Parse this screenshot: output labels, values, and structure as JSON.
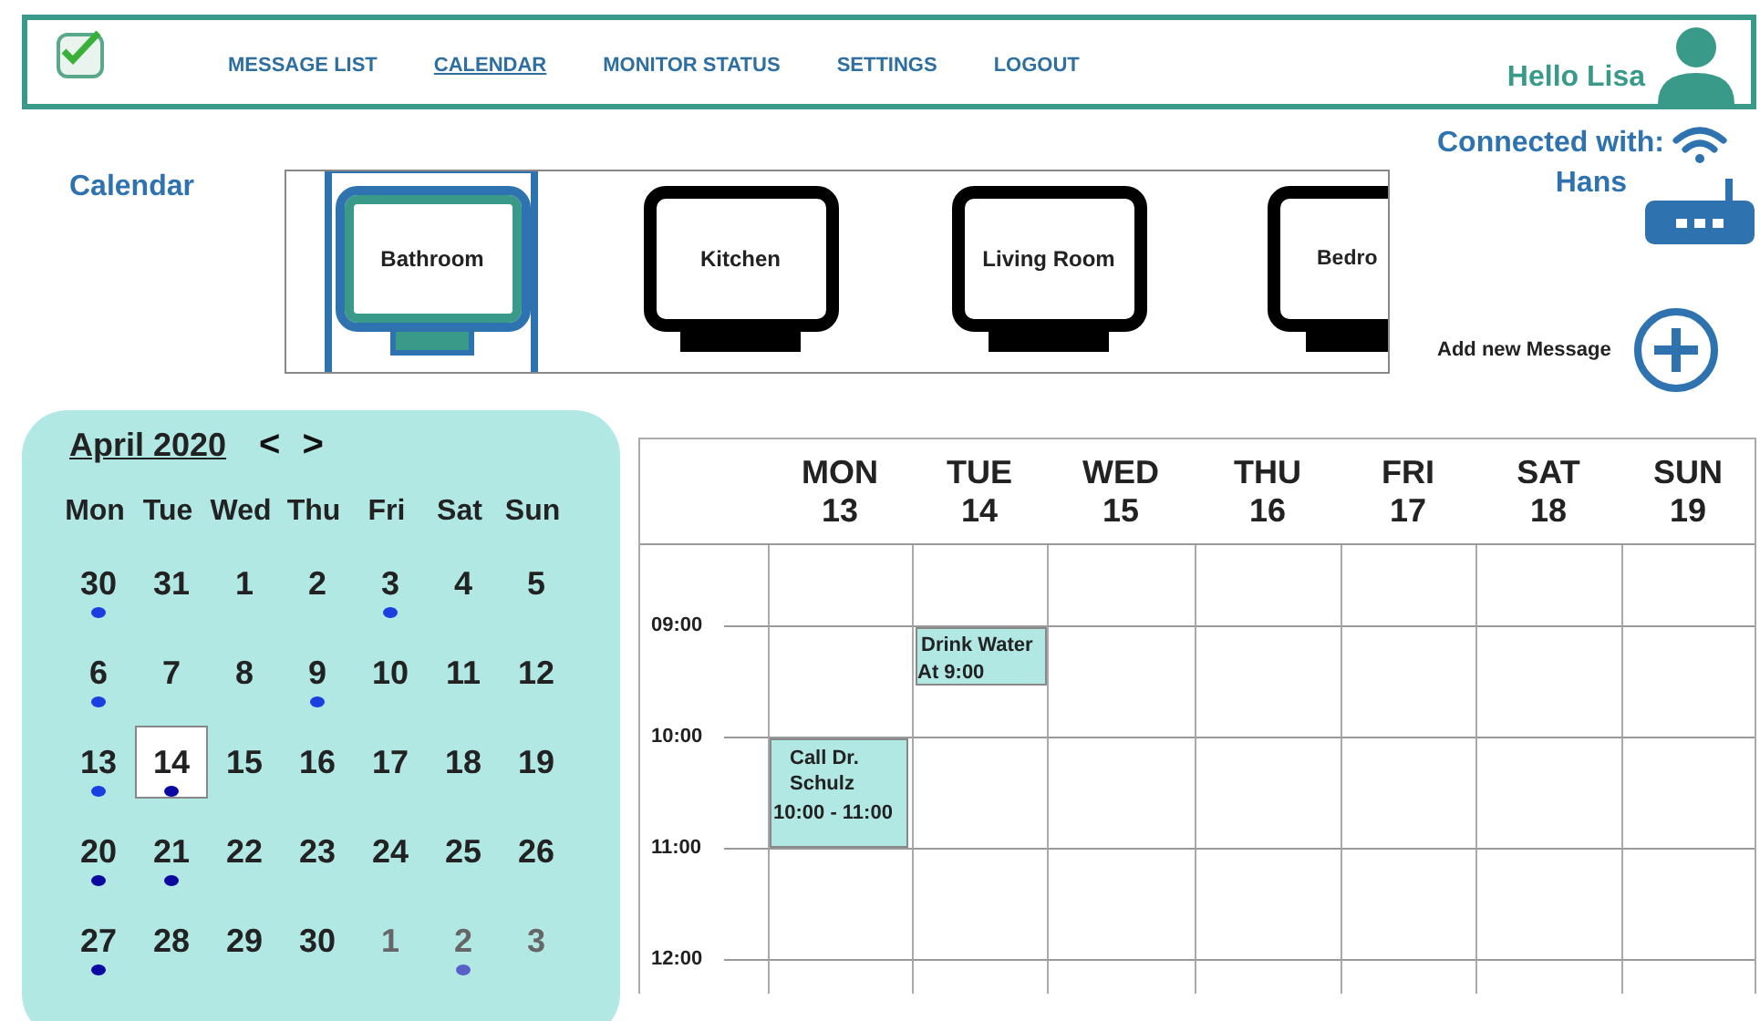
{
  "header": {
    "nav": [
      {
        "label": "MESSAGE LIST",
        "selected": false
      },
      {
        "label": "CALENDAR",
        "selected": true
      },
      {
        "label": "MONITOR STATUS",
        "selected": false
      },
      {
        "label": "SETTINGS",
        "selected": false
      },
      {
        "label": "LOGOUT",
        "selected": false
      }
    ],
    "greeting": "Hello Lisa"
  },
  "page_title": "Calendar",
  "devices": [
    {
      "label": "Bathroom",
      "selected": true
    },
    {
      "label": "Kitchen",
      "selected": false
    },
    {
      "label": "Living Room",
      "selected": false
    },
    {
      "label": "Bedro",
      "selected": false
    }
  ],
  "connection": {
    "label": "Connected with:",
    "device": "Hans"
  },
  "add_message": {
    "label": "Add new Message"
  },
  "mini_calendar": {
    "month": "April 2020",
    "prev": "<",
    "next": ">",
    "weekdays": [
      "Mon",
      "Tue",
      "Wed",
      "Thu",
      "Fri",
      "Sat",
      "Sun"
    ],
    "weeks": [
      [
        {
          "day": "30",
          "selected": false,
          "muted": false,
          "color": "#1a3fe0"
        },
        {
          "day": "31",
          "selected": false,
          "muted": false
        },
        {
          "day": "1",
          "selected": false,
          "muted": false
        },
        {
          "day": "2",
          "selected": false,
          "muted": false
        },
        {
          "day": "3",
          "selected": false,
          "muted": false,
          "color": "#1a3fe0"
        },
        {
          "day": "4",
          "selected": false,
          "muted": false
        },
        {
          "day": "5",
          "selected": false,
          "muted": false
        }
      ],
      [
        {
          "day": "6",
          "selected": false,
          "muted": false,
          "color": "#1a3fe0"
        },
        {
          "day": "7",
          "selected": false,
          "muted": false
        },
        {
          "day": "8",
          "selected": false,
          "muted": false
        },
        {
          "day": "9",
          "selected": false,
          "muted": false,
          "color": "#1a3fe0"
        },
        {
          "day": "10",
          "selected": false,
          "muted": false
        },
        {
          "day": "11",
          "selected": false,
          "muted": false
        },
        {
          "day": "12",
          "selected": false,
          "muted": false
        }
      ],
      [
        {
          "day": "13",
          "selected": false,
          "muted": false,
          "color": "#1a3fe0"
        },
        {
          "day": "14",
          "selected": true,
          "muted": false,
          "color": "#0a0aa0"
        },
        {
          "day": "15",
          "selected": false,
          "muted": false
        },
        {
          "day": "16",
          "selected": false,
          "muted": false
        },
        {
          "day": "17",
          "selected": false,
          "muted": false
        },
        {
          "day": "18",
          "selected": false,
          "muted": false
        },
        {
          "day": "19",
          "selected": false,
          "muted": false
        }
      ],
      [
        {
          "day": "20",
          "selected": false,
          "muted": false,
          "color": "#0a0aa0"
        },
        {
          "day": "21",
          "selected": false,
          "muted": false,
          "color": "#0a0aa0"
        },
        {
          "day": "22",
          "selected": false,
          "muted": false
        },
        {
          "day": "23",
          "selected": false,
          "muted": false
        },
        {
          "day": "24",
          "selected": false,
          "muted": false
        },
        {
          "day": "25",
          "selected": false,
          "muted": false
        },
        {
          "day": "26",
          "selected": false,
          "muted": false
        }
      ],
      [
        {
          "day": "27",
          "selected": false,
          "muted": false,
          "color": "#0a0aa0"
        },
        {
          "day": "28",
          "selected": false,
          "muted": false
        },
        {
          "day": "29",
          "selected": false,
          "muted": false
        },
        {
          "day": "30",
          "selected": false,
          "muted": false
        },
        {
          "day": "1",
          "selected": false,
          "muted": true
        },
        {
          "day": "2",
          "selected": false,
          "muted": true,
          "color": "#5a5fc8"
        },
        {
          "day": "3",
          "selected": false,
          "muted": true
        }
      ]
    ]
  },
  "week_view": {
    "days": [
      {
        "name": "MON",
        "date": "13"
      },
      {
        "name": "TUE",
        "date": "14"
      },
      {
        "name": "WED",
        "date": "15"
      },
      {
        "name": "THU",
        "date": "16"
      },
      {
        "name": "FRI",
        "date": "17"
      },
      {
        "name": "SAT",
        "date": "18"
      },
      {
        "name": "SUN",
        "date": "19"
      }
    ],
    "hours": [
      {
        "time": "09:00",
        "cells": [
          {
            "kind": "empty"
          },
          {
            "kind": "half",
            "title": "Drink Water",
            "time": "At 9:00"
          },
          {
            "kind": "empty"
          },
          {
            "kind": "empty"
          },
          {
            "kind": "empty"
          },
          {
            "kind": "empty"
          },
          {
            "kind": "empty"
          }
        ]
      },
      {
        "time": "10:00",
        "cells": [
          {
            "kind": "hour",
            "title": "Call Dr. Schulz",
            "time": "10:00 - 11:00"
          },
          {
            "kind": "empty"
          },
          {
            "kind": "empty"
          },
          {
            "kind": "empty"
          },
          {
            "kind": "empty"
          },
          {
            "kind": "empty"
          },
          {
            "kind": "empty"
          }
        ]
      },
      {
        "time": "11:00",
        "cells": [
          {
            "kind": "empty"
          },
          {
            "kind": "empty"
          },
          {
            "kind": "empty"
          },
          {
            "kind": "empty"
          },
          {
            "kind": "empty"
          },
          {
            "kind": "empty"
          },
          {
            "kind": "empty"
          }
        ]
      },
      {
        "time": "12:00",
        "cells": [
          {
            "kind": "empty"
          },
          {
            "kind": "empty"
          },
          {
            "kind": "empty"
          },
          {
            "kind": "empty"
          },
          {
            "kind": "empty"
          },
          {
            "kind": "empty"
          },
          {
            "kind": "empty"
          }
        ]
      }
    ]
  }
}
